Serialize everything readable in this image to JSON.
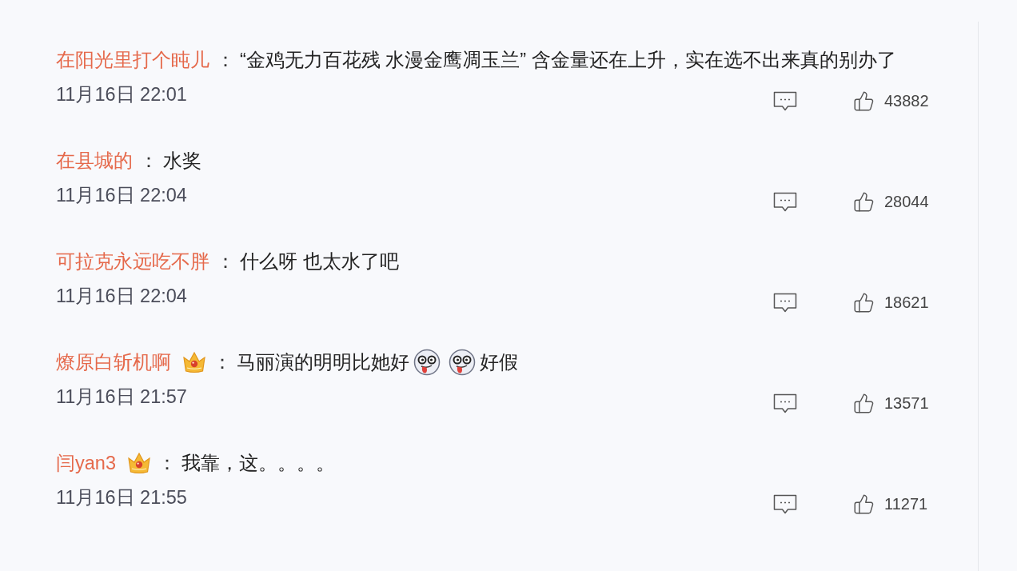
{
  "comments": [
    {
      "username": "在阳光里打个盹儿",
      "member_badge": false,
      "separator": "：",
      "content": [
        {
          "kind": "text",
          "text": "“金鸡无力百花残 水漫金鹰凋玉兰” 含金量还在上升，实在选不出来真的别办了"
        }
      ],
      "time": "11月16日 22:01",
      "likes": "43882"
    },
    {
      "username": "在县城的",
      "member_badge": false,
      "separator": "：",
      "content": [
        {
          "kind": "text",
          "text": "水奖"
        }
      ],
      "time": "11月16日 22:04",
      "likes": "28044"
    },
    {
      "username": "可拉克永远吃不胖",
      "member_badge": false,
      "separator": "：",
      "content": [
        {
          "kind": "text",
          "text": "什么呀 也太水了吧"
        }
      ],
      "time": "11月16日 22:04",
      "likes": "18621"
    },
    {
      "username": "燎原白斩机啊",
      "member_badge": true,
      "separator": "：",
      "content": [
        {
          "kind": "text",
          "text": "马丽演的明明比她好"
        },
        {
          "kind": "emoji"
        },
        {
          "kind": "emoji"
        },
        {
          "kind": "text",
          "text": "好假"
        }
      ],
      "time": "11月16日 21:57",
      "likes": "13571"
    },
    {
      "username": "闫yan3",
      "member_badge": true,
      "separator": "：",
      "content": [
        {
          "kind": "text",
          "text": "我靠，这。。。。"
        }
      ],
      "time": "11月16日 21:55",
      "likes": "11271"
    }
  ]
}
